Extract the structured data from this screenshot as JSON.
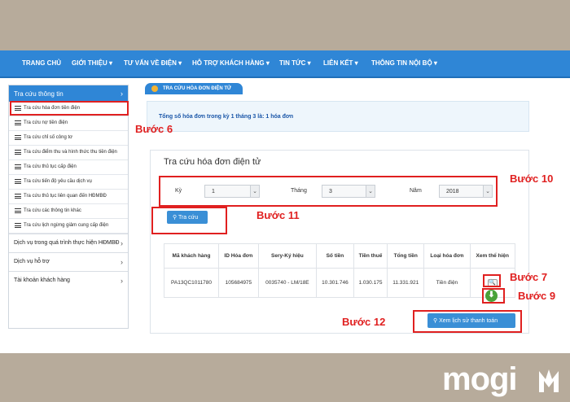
{
  "nav": {
    "items": [
      "TRANG CHỦ",
      "GIỚI THIỆU ▾",
      "TƯ VẤN VỀ ĐIỆN ▾",
      "HỖ TRỢ KHÁCH HÀNG ▾",
      "TIN TỨC ▾",
      "LIÊN KẾT ▾",
      "THÔNG TIN NỘI BỘ ▾"
    ]
  },
  "sidebar": {
    "header": "Tra cứu thông tin",
    "sub_items": [
      "Tra cứu hóa đơn tiền điện",
      "Tra cứu nợ tiền điện",
      "Tra cứu chỉ số công tơ",
      "Tra cứu điểm thu và hình thức thu tiền điện",
      "Tra cứu thủ tục cấp điện",
      "Tra cứu tiến độ yêu cầu dịch vụ",
      "Tra cứu thủ tục liên quan đến HĐMBĐ",
      "Tra cứu các thông tin khác",
      "Tra cứu lịch ngừng giảm cung cấp điện"
    ],
    "main_items": [
      "Dịch vụ trong quá trình thực hiện HĐMBĐ",
      "Dịch vụ hỗ trợ",
      "Tài khoản khách hàng"
    ]
  },
  "content": {
    "tab_label": "TRA CỨU HÓA ĐƠN ĐIỆN TỬ",
    "notice": "Tổng số hóa đơn trong kỳ 1 tháng 3 là: 1 hóa đơn",
    "panel_title": "Tra cứu hóa đơn điện tử",
    "filters": {
      "ky_label": "Kỳ",
      "ky_value": "1",
      "thang_label": "Tháng",
      "thang_value": "3",
      "nam_label": "Năm",
      "nam_value": "2018"
    },
    "search_button": "Tra cứu",
    "history_button": "Xem lịch sử thanh toán",
    "table": {
      "headers": [
        "Mã khách hàng",
        "ID Hóa đơn",
        "Sery-Ký hiệu",
        "Số tiền",
        "Tiền thuế",
        "Tổng tiền",
        "Loại hóa đơn",
        "Xem thể hiện"
      ],
      "row": [
        "PA13QC1011780",
        "105684975",
        "0035740 - LM/18E",
        "10.301.746",
        "1.030.175",
        "11.331.921",
        "Tiền điện",
        ""
      ]
    }
  },
  "annotations": {
    "step6": "Bước 6",
    "step7": "Bước 7",
    "step9": "Bước 9",
    "step10": "Bước 10",
    "step11": "Bước 11",
    "step12": "Bước 12"
  },
  "branding": {
    "logo": "mogi"
  },
  "colors": {
    "nav": "#2f86d6",
    "annotation": "#e02020",
    "background": "#b7ab9b"
  }
}
